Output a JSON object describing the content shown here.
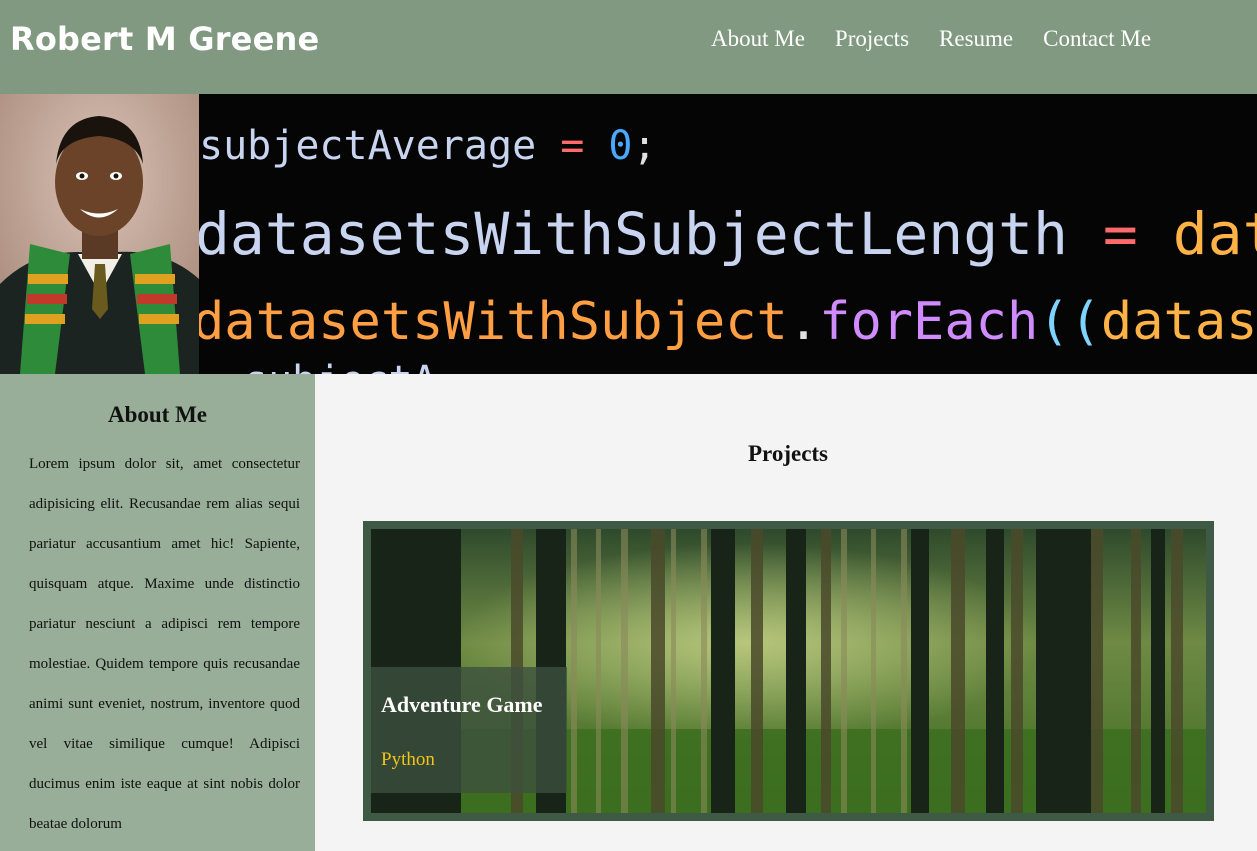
{
  "header": {
    "title": "Robert M Greene",
    "nav": [
      {
        "label": "About Me"
      },
      {
        "label": "Projects"
      },
      {
        "label": "Resume"
      },
      {
        "label": "Contact Me"
      }
    ]
  },
  "hero": {
    "photo_icon": "profile-photo",
    "code_lines": [
      {
        "tokens": [
          {
            "text": "subjectAverage",
            "color": "#c8d4f0"
          },
          {
            "text": " = ",
            "color": "#ff6b6b"
          },
          {
            "text": "0",
            "color": "#4aa8ff"
          },
          {
            "text": ";",
            "color": "#e0e0e0"
          }
        ]
      },
      {
        "tokens": [
          {
            "text": "datasetsWithSubjectLength",
            "color": "#c8d4f0"
          },
          {
            "text": " = ",
            "color": "#ff6b6b"
          },
          {
            "text": "datasetsWithSu",
            "color": "#ffb347"
          }
        ]
      },
      {
        "tokens": [
          {
            "text": "datasetsWithSubject",
            "color": "#ff9f43"
          },
          {
            "text": ".",
            "color": "#e0e0e0"
          },
          {
            "text": "forEach",
            "color": "#d08cff"
          },
          {
            "text": "((",
            "color": "#7fd4ff"
          },
          {
            "text": "dataset",
            "color": "#ffb347"
          },
          {
            "text": ")",
            "color": "#ffd84a"
          },
          {
            "text": " => ",
            "color": "#ff6b6b"
          }
        ]
      },
      {
        "tokens": [
          {
            "text": "subjectA",
            "color": "#c8d4f0"
          }
        ]
      }
    ]
  },
  "about": {
    "heading": "About Me",
    "body": "Lorem ipsum dolor sit, amet consectetur adipisicing elit. Recusandae rem alias sequi pariatur accusantium amet hic! Sapiente, quisquam atque. Maxime unde distinctio pariatur nesciunt a adipisci rem tempore molestiae. Quidem tempore quis recusandae animi sunt eveniet, nostrum, inventore quod vel vitae similique cumque! Adipisci ducimus enim iste eaque at sint nobis dolor beatae dolorum"
  },
  "projects": {
    "heading": "Projects",
    "items": [
      {
        "title": "Adventure Game",
        "language": "Python",
        "image_icon": "forest-image"
      }
    ]
  },
  "colors": {
    "header_bg": "#819981",
    "sidebar_bg": "#98ae98",
    "card_border": "#3e5a45",
    "language_accent": "#f0c419"
  }
}
